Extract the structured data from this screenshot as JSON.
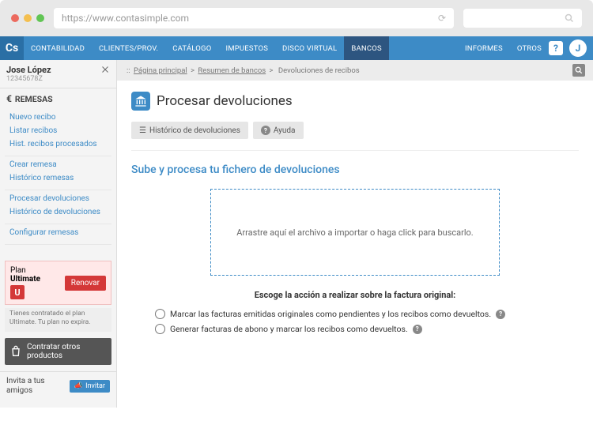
{
  "browser": {
    "url": "https://www.contasimple.com"
  },
  "topnav": {
    "logo": "Cs",
    "items": [
      "CONTABILIDAD",
      "CLIENTES/PROV.",
      "CATÁLOGO",
      "IMPUESTOS",
      "DISCO VIRTUAL",
      "BANCOS",
      "INFORMES",
      "OTROS"
    ],
    "active_index": 5,
    "avatar_initial": "J"
  },
  "user": {
    "name": "Jose López",
    "id": "12345678Z"
  },
  "sidebar": {
    "section_label": "REMESAS",
    "group1": [
      "Nuevo recibo",
      "Listar recibos",
      "Hist. recibos procesados"
    ],
    "group2": [
      "Crear remesa",
      "Histórico remesas"
    ],
    "group3": [
      "Procesar devoluciones",
      "Histórico de devoluciones"
    ],
    "group4": [
      "Configurar remesas"
    ],
    "plan": {
      "label1": "Plan",
      "label2": "Ultimate",
      "badge": "U",
      "renew": "Renovar",
      "note": "Tienes contratado el plan Ultimate. Tu plan no expira."
    },
    "contract_label": "Contratar otros productos",
    "invite_label": "Invita a tus amigos",
    "invite_btn": "Invitar"
  },
  "breadcrumb": {
    "home": "Página principal",
    "mid": "Resumen de bancos",
    "current": "Devoluciones de recibos",
    "sep": ">",
    "prefix": "::"
  },
  "page": {
    "title": "Procesar devoluciones",
    "btn_history": "Histórico de devoluciones",
    "btn_help": "Ayuda",
    "section_title": "Sube y procesa tu fichero de devoluciones",
    "dropzone_text": "Arrastre aquí el archivo a importar o haga click para buscarlo.",
    "action_label": "Escoge la acción a realizar sobre la factura original:",
    "option1": "Marcar las facturas emitidas originales como pendientes y los recibos como devueltos.",
    "option2": "Generar facturas de abono y marcar los recibos como devueltos."
  }
}
